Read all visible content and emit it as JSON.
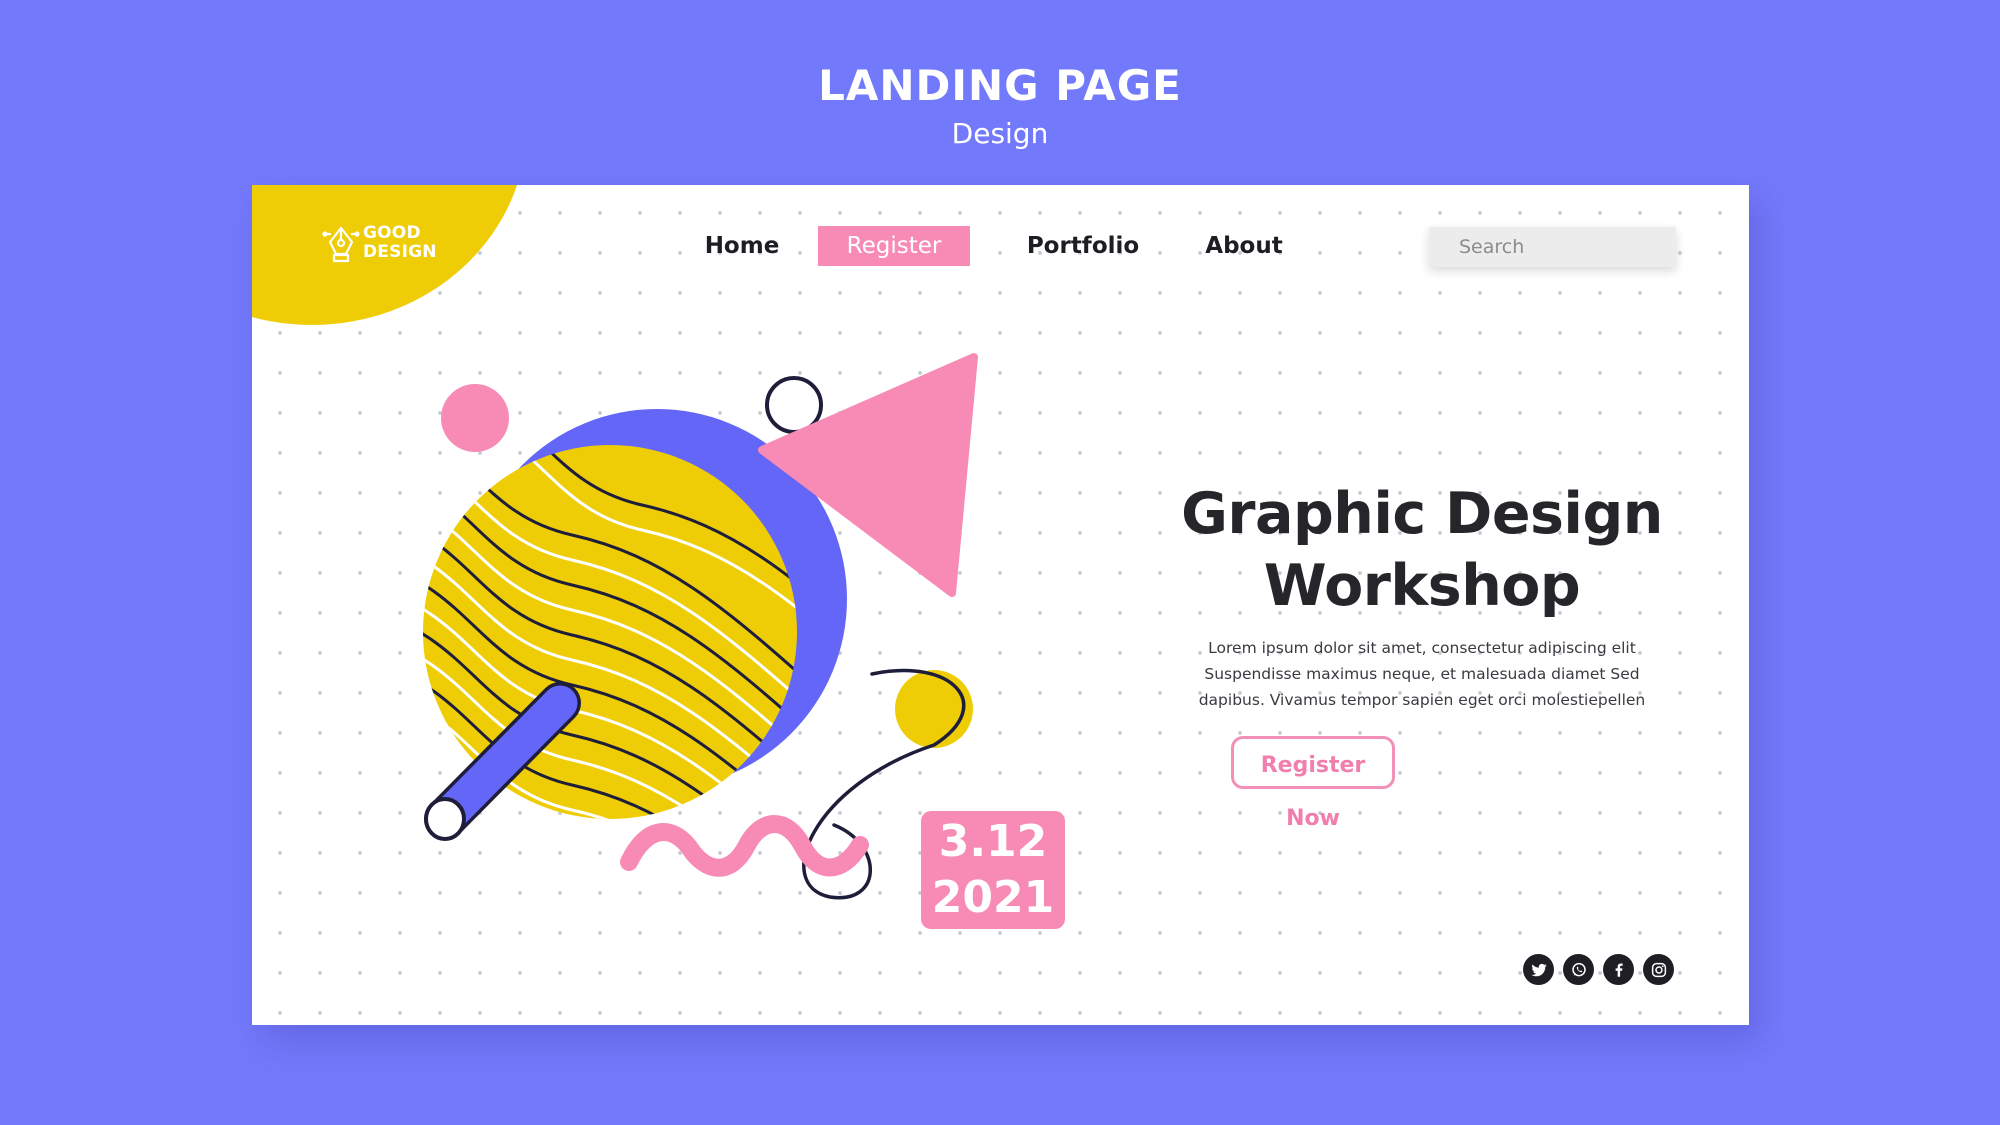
{
  "heading": {
    "title": "LANDING PAGE",
    "subtitle": "Design"
  },
  "logo": {
    "line1": "GOOD",
    "line2": "DESIGN"
  },
  "nav": {
    "items": [
      {
        "label": "Home"
      },
      {
        "label": "Register",
        "active": true
      },
      {
        "label": "Portfolio"
      },
      {
        "label": "About"
      }
    ]
  },
  "search": {
    "placeholder": "Search"
  },
  "hero": {
    "title_line1": "Graphic Design",
    "title_line2": "Workshop",
    "body_line1": "Lorem ipsum dolor sit amet, consectetur adipiscing elit",
    "body_line2": "Suspendisse maximus  neque, et malesuada diamet Sed",
    "body_line3": "dapibus. Vivamus tempor sapien eget orci molestiepellen",
    "cta_label": "Register Now"
  },
  "date": {
    "line1": "3.12",
    "line2": "2021"
  },
  "social": [
    "twitter-icon",
    "whatsapp-icon",
    "facebook-icon",
    "instagram-icon"
  ],
  "colors": {
    "background": "#7379fb",
    "yellow": "#eecd07",
    "pink": "#f78bb5",
    "blue": "#6366f6",
    "dark": "#1e1e24"
  }
}
